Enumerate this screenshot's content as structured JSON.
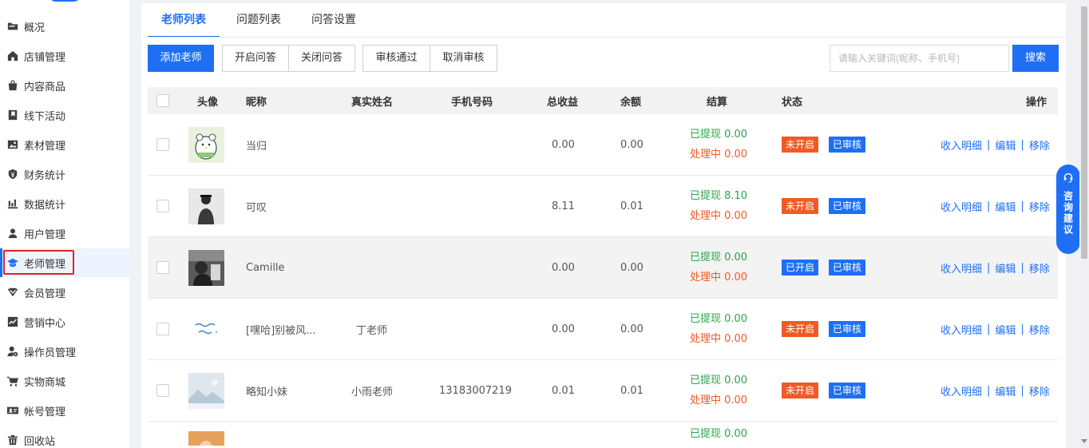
{
  "sidebar": {
    "items": [
      {
        "label": "概况",
        "icon": "folder-icon"
      },
      {
        "label": "店铺管理",
        "icon": "home-icon"
      },
      {
        "label": "内容商品",
        "icon": "bag-icon"
      },
      {
        "label": "线下活动",
        "icon": "bookmark-icon"
      },
      {
        "label": "素材管理",
        "icon": "image-icon"
      },
      {
        "label": "财务统计",
        "icon": "yuan-shield-icon"
      },
      {
        "label": "数据统计",
        "icon": "bar-chart-icon"
      },
      {
        "label": "用户管理",
        "icon": "user-icon"
      },
      {
        "label": "老师管理",
        "icon": "graduation-cap-icon",
        "active": true
      },
      {
        "label": "会员管理",
        "icon": "vip-icon"
      },
      {
        "label": "营销中心",
        "icon": "trend-icon"
      },
      {
        "label": "操作员管理",
        "icon": "operator-icon"
      },
      {
        "label": "实物商城",
        "icon": "cart-icon"
      },
      {
        "label": "帐号管理",
        "icon": "id-card-icon"
      },
      {
        "label": "回收站",
        "icon": "trash-icon"
      }
    ]
  },
  "tabs": [
    {
      "label": "老师列表",
      "active": true
    },
    {
      "label": "问题列表"
    },
    {
      "label": "问答设置"
    }
  ],
  "toolbar": {
    "add_teacher": "添加老师",
    "open_qa": "开启问答",
    "close_qa": "关闭问答",
    "approve": "审核通过",
    "cancel_review": "取消审核",
    "search_placeholder": "请输入关键词(昵称、手机号)",
    "search_button": "搜索"
  },
  "table": {
    "headers": {
      "avatar": "头像",
      "nickname": "昵称",
      "real_name": "真实姓名",
      "phone": "手机号码",
      "total_income": "总收益",
      "balance": "余额",
      "settlement": "结算",
      "status": "状态",
      "actions": "操作"
    },
    "rows": [
      {
        "nickname": "当归",
        "real_name": "",
        "phone": "",
        "total_income": "0.00",
        "balance": "0.00",
        "withdrawn": "已提现 0.00",
        "processing": "处理中 0.00",
        "qa_status": "未开启",
        "review_status": "已审核"
      },
      {
        "nickname": "可叹",
        "real_name": "",
        "phone": "",
        "total_income": "8.11",
        "balance": "0.01",
        "withdrawn": "已提现 8.10",
        "processing": "处理中 0.00",
        "qa_status": "未开启",
        "review_status": "已审核"
      },
      {
        "nickname": "Camille",
        "real_name": "",
        "phone": "",
        "total_income": "0.00",
        "balance": "0.00",
        "withdrawn": "已提现 0.00",
        "processing": "处理中 0.00",
        "qa_status": "已开启",
        "review_status": "已审核"
      },
      {
        "nickname": "[嘿哈]别被风...",
        "real_name": "丁老师",
        "phone": "",
        "total_income": "0.00",
        "balance": "0.00",
        "withdrawn": "已提现 0.00",
        "processing": "处理中 0.00",
        "qa_status": "未开启",
        "review_status": "已审核"
      },
      {
        "nickname": "略知小妹",
        "real_name": "小雨老师",
        "phone": "13183007219",
        "total_income": "0.01",
        "balance": "0.01",
        "withdrawn": "已提现 0.00",
        "processing": "处理中 0.00",
        "qa_status": "未开启",
        "review_status": "已审核"
      },
      {
        "nickname": "",
        "real_name": "",
        "phone": "",
        "total_income": "",
        "balance": "",
        "withdrawn": "已提现 0.00",
        "processing": "",
        "qa_status": "",
        "review_status": ""
      }
    ],
    "actions": {
      "income_detail": "收入明细",
      "edit": "编辑",
      "remove": "移除",
      "separator": "|"
    }
  },
  "float_widget": {
    "label": "咨询建议"
  },
  "colors": {
    "accent": "#1e6ff5",
    "orange": "#f15a24",
    "green": "#2aa64a",
    "highlight": "#e32323"
  }
}
